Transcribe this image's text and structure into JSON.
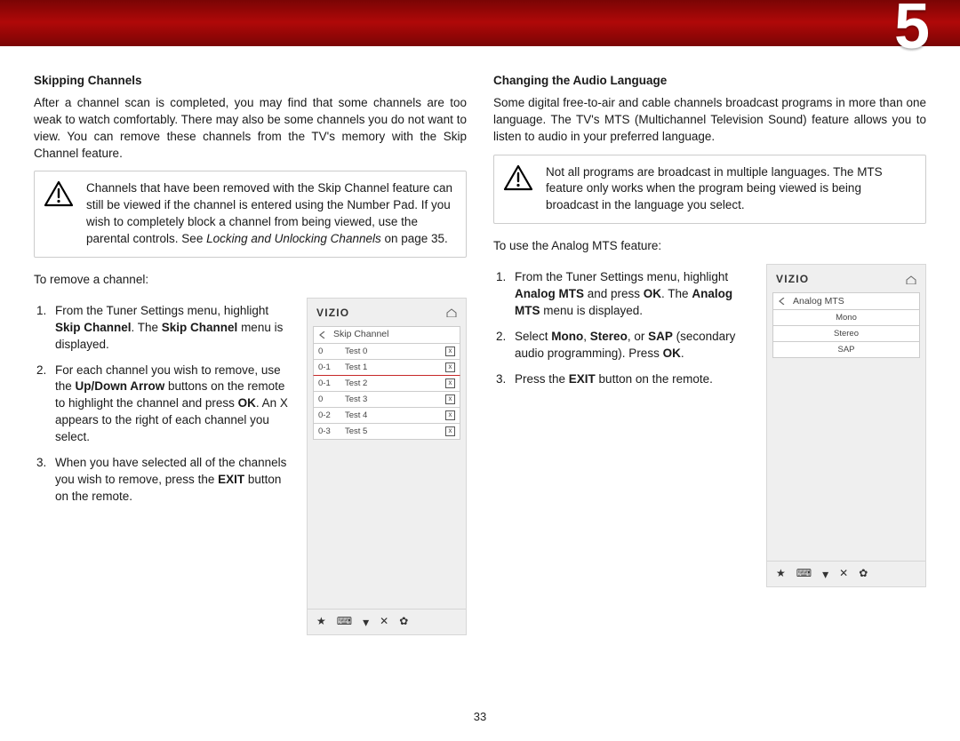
{
  "chapter": "5",
  "page_number": "33",
  "left": {
    "heading": "Skipping Channels",
    "intro": "After a channel scan is completed, you may find that some channels are too weak to watch comfortably. There may also be some channels you do not want to view. You can remove these channels from the TV's memory with the Skip Channel feature.",
    "note_a": "Channels that have been removed with the Skip Channel feature can still be viewed if the channel is entered using the Number Pad. If you wish to completely block a channel from being viewed, use the parental controls. See ",
    "note_b_italic": "Locking and Unlocking Channels",
    "note_c": " on page 35.",
    "lead": "To remove a channel:",
    "step1_a": "From the Tuner Settings menu, highlight ",
    "step1_b": "Skip Channel",
    "step1_c": ". The ",
    "step1_d": "Skip Channel",
    "step1_e": " menu is displayed.",
    "step2_a": "For each channel you wish to remove, use the ",
    "step2_b": "Up/Down Arrow",
    "step2_c": " buttons on the remote to highlight the channel and press ",
    "step2_d": "OK",
    "step2_e": ". An X appears to the right of each channel you select.",
    "step3_a": "When you have selected all of the channels you wish to remove, press the ",
    "step3_b": "EXIT",
    "step3_c": " button on the remote.",
    "device": {
      "brand": "VIZIO",
      "menu": "Skip Channel",
      "rows": [
        {
          "ch": "0",
          "name": "Test 0"
        },
        {
          "ch": "0-1",
          "name": "Test 1"
        },
        {
          "ch": "0-1",
          "name": "Test 2"
        },
        {
          "ch": "0",
          "name": "Test 3"
        },
        {
          "ch": "0-2",
          "name": "Test 4"
        },
        {
          "ch": "0-3",
          "name": "Test 5"
        }
      ]
    }
  },
  "right": {
    "heading": "Changing the Audio Language",
    "intro": "Some digital free-to-air and cable channels broadcast programs in more than one language. The TV's MTS (Multichannel Television Sound) feature allows you to listen to audio in your preferred language.",
    "note": "Not all programs are broadcast in multiple languages. The MTS feature only works when the program being viewed is being broadcast in the language you select.",
    "lead": "To use the Analog MTS feature:",
    "step1_a": "From the Tuner Settings menu, highlight ",
    "step1_b": "Analog MTS",
    "step1_c": " and press ",
    "step1_d": "OK",
    "step1_e": ". The ",
    "step1_f": "Analog MTS",
    "step1_g": " menu is displayed.",
    "step2_a": "Select ",
    "step2_b": "Mono",
    "step2_c": ", ",
    "step2_d": "Stereo",
    "step2_e": ", or ",
    "step2_f": "SAP",
    "step2_g": " (secondary audio programming). Press ",
    "step2_h": "OK",
    "step2_i": ".",
    "step3_a": "Press the ",
    "step3_b": "EXIT",
    "step3_c": " button on the remote.",
    "device": {
      "brand": "VIZIO",
      "menu": "Analog MTS",
      "opts": [
        "Mono",
        "Stereo",
        "SAP"
      ]
    }
  }
}
